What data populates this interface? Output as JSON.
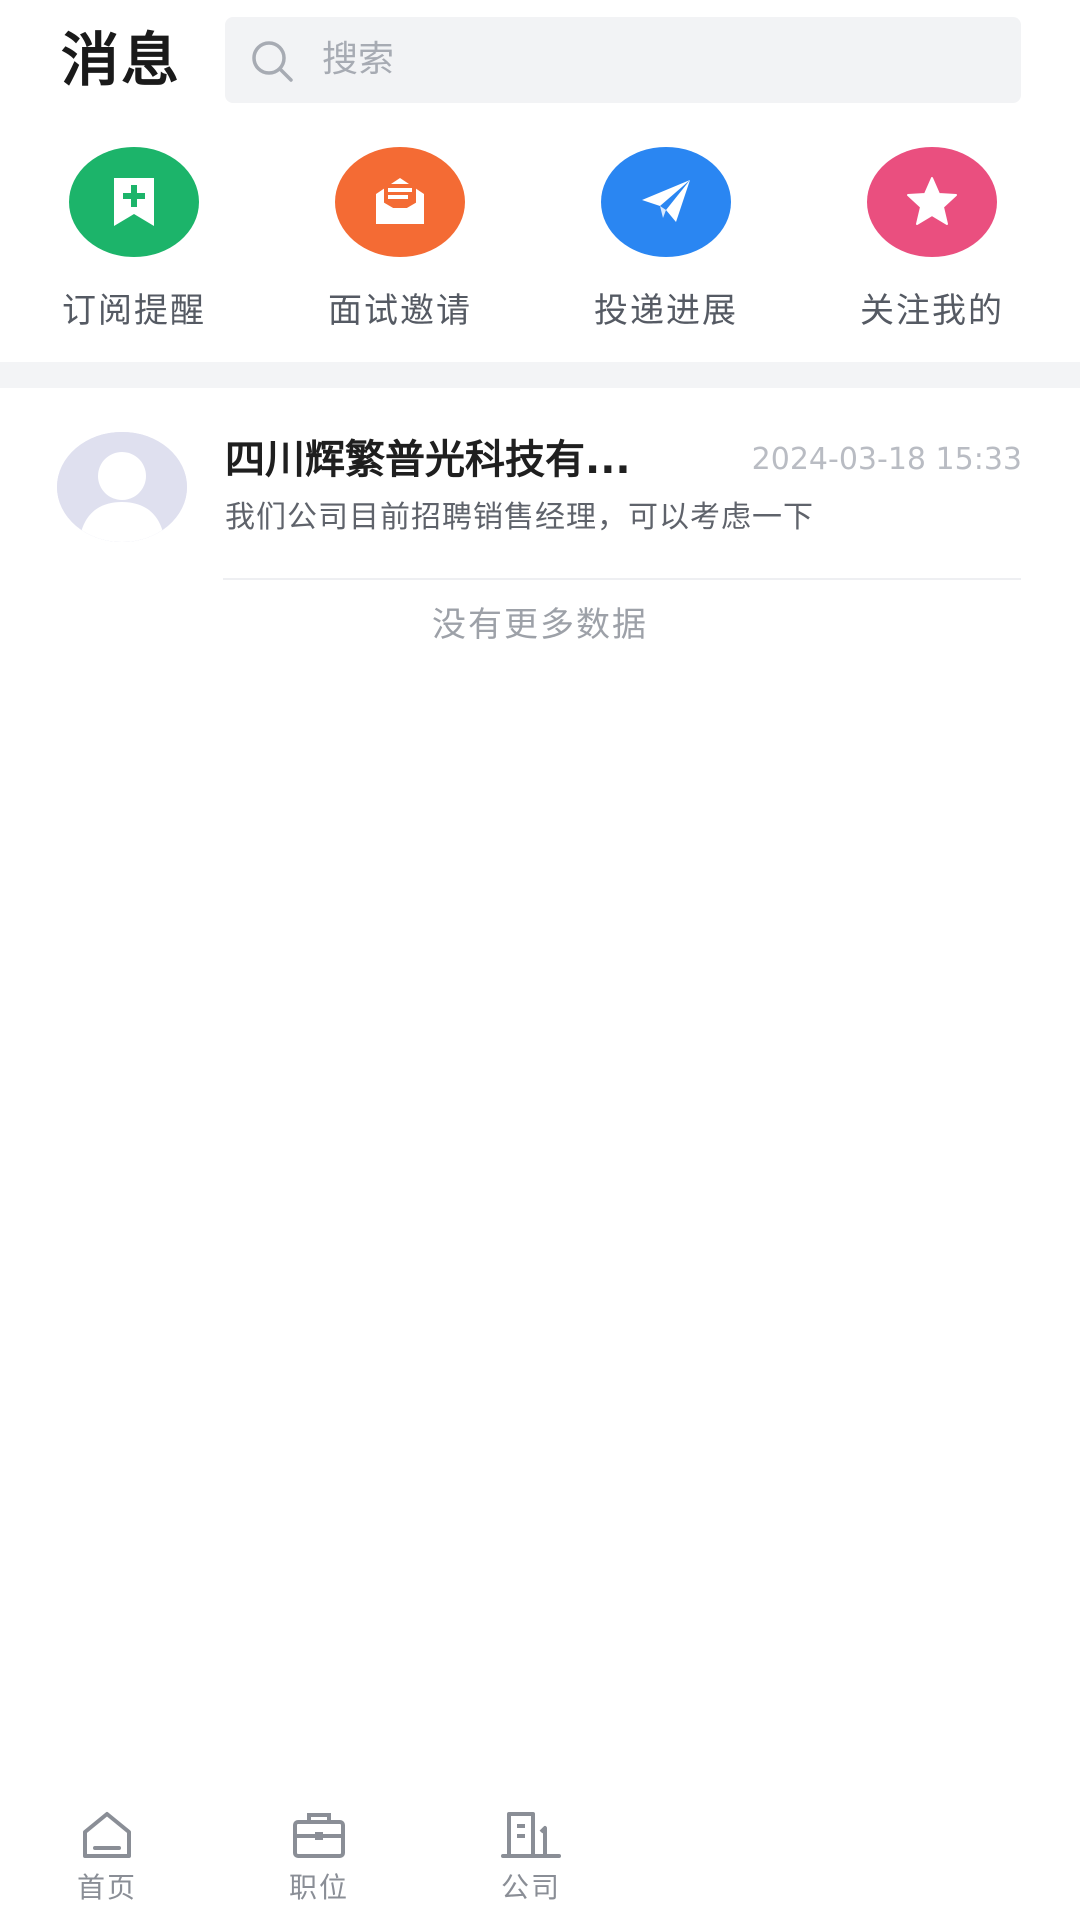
{
  "header": {
    "title": "消息",
    "search_placeholder": "搜索",
    "search_icon": "search-icon"
  },
  "shortcuts": [
    {
      "label": "订阅提醒",
      "icon": "bookmark-plus-icon",
      "color": "#1cb46a"
    },
    {
      "label": "面试邀请",
      "icon": "envelope-icon",
      "color": "#f46b34"
    },
    {
      "label": "投递进展",
      "icon": "paper-plane-icon",
      "color": "#2a86f2"
    },
    {
      "label": "关注我的",
      "icon": "star-icon",
      "color": "#ea4f7f"
    }
  ],
  "messages": [
    {
      "company": "四川辉繁普光科技有...",
      "time": "2024-03-18 15:33",
      "preview": "我们公司目前招聘销售经理，可以考虑一下",
      "avatar_icon": "default-avatar-icon"
    }
  ],
  "list_footer": "没有更多数据",
  "tabbar": {
    "items": [
      {
        "label": "首页",
        "icon": "home-icon"
      },
      {
        "label": "职位",
        "icon": "briefcase-icon"
      },
      {
        "label": "公司",
        "icon": "building-icon"
      }
    ]
  }
}
